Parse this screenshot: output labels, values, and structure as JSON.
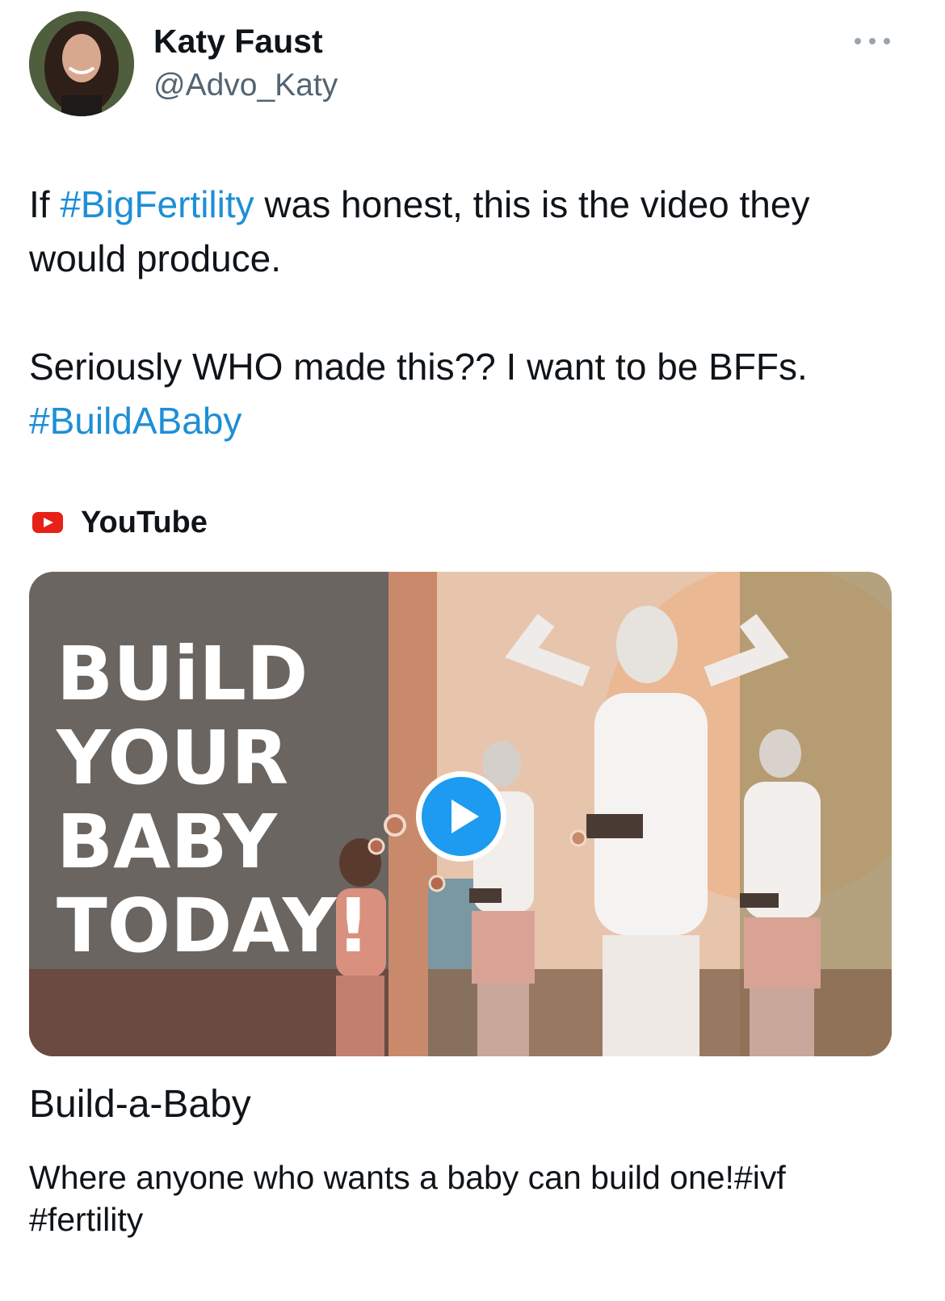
{
  "author": {
    "display_name": "Katy Faust",
    "handle": "@Advo_Katy"
  },
  "tweet": {
    "p1_prefix": "If ",
    "p1_hashtag": "#BigFertility",
    "p1_suffix": " was honest, this is the video they would produce.",
    "p2_text": "Seriously WHO made this?? I want to be BFFs. ",
    "p2_hashtag": "#BuildABaby"
  },
  "card": {
    "source": "YouTube",
    "thumbnail_title": "BUiLD YOUR BABY TODAY!",
    "title": "Build-a-Baby",
    "description": "Where anyone who wants a baby can build one!#ivf #fertility"
  },
  "colors": {
    "hashtag": "#1d8fd6",
    "play_button": "#1d9bf0",
    "youtube_red": "#e62117",
    "handle_gray": "#536471"
  },
  "icons": [
    "more-options-icon",
    "youtube-icon",
    "play-icon"
  ]
}
